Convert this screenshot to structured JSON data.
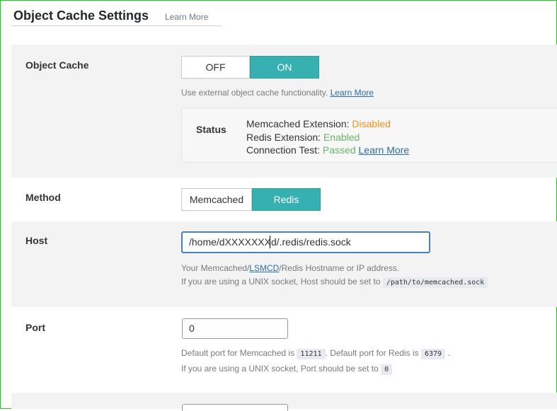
{
  "header": {
    "title": "Object Cache Settings",
    "learn_more": "Learn More"
  },
  "object_cache": {
    "label": "Object Cache",
    "toggle": {
      "off_label": "OFF",
      "on_label": "ON",
      "selected": "ON"
    },
    "description": "Use external object cache functionality.",
    "description_link": "Learn More",
    "status": {
      "label": "Status",
      "memcached_label": "Memcached Extension:",
      "memcached_value": "Disabled",
      "redis_label": "Redis Extension:",
      "redis_value": "Enabled",
      "connection_label": "Connection Test:",
      "connection_value": "Passed",
      "connection_link": "Learn More"
    }
  },
  "method": {
    "label": "Method",
    "options": [
      "Memcached",
      "Redis"
    ],
    "selected": "Redis"
  },
  "host": {
    "label": "Host",
    "value": "/home/dXXXXXXXd/.redis/redis.sock",
    "desc1_pre": "Your Memcached/",
    "desc1_link": "LSMCD",
    "desc1_post": "/Redis Hostname or IP address.",
    "desc2": "If you are using a UNIX socket, Host should be set to",
    "desc2_code": "/path/to/memcached.sock"
  },
  "port": {
    "label": "Port",
    "value": "0",
    "desc1_a": "Default port for Memcached is",
    "memcached_port": "11211",
    "desc1_b": ". Default port for Redis is",
    "redis_port": "6379",
    "desc1_c": ".",
    "desc2": "If you are using a UNIX socket, Port should be set to",
    "desc2_code": "0"
  },
  "colors": {
    "accent": "#36b0b0",
    "disabled": "#f0901e",
    "enabled": "#6ab56a",
    "link": "#2b6ca3"
  }
}
